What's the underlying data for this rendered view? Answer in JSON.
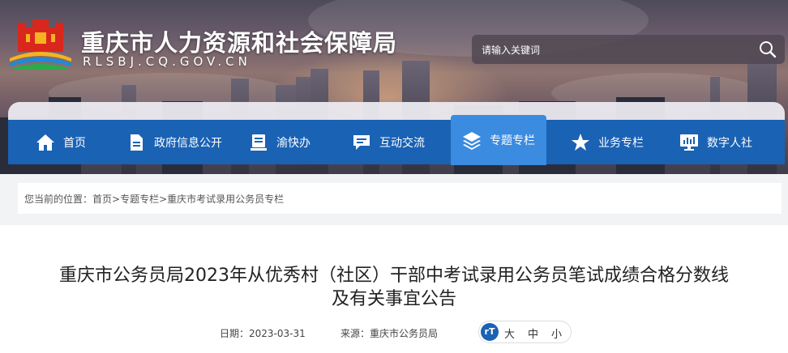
{
  "header": {
    "site_title": "重庆市人力资源和社会保障局",
    "site_domain": "RLSBJ.CQ.GOV.CN",
    "search_placeholder": "请输入关键词"
  },
  "nav": {
    "items": [
      {
        "label": "首页",
        "icon": "home-icon"
      },
      {
        "label": "政府信息公开",
        "icon": "document-icon"
      },
      {
        "label": "渝快办",
        "icon": "service-icon"
      },
      {
        "label": "互动交流",
        "icon": "chat-icon"
      },
      {
        "label": "专题专栏",
        "icon": "layers-icon",
        "active": true
      },
      {
        "label": "业务专栏",
        "icon": "star-icon"
      },
      {
        "label": "数字人社",
        "icon": "monitor-icon"
      }
    ]
  },
  "breadcrumb": {
    "prefix": "您当前的位置：",
    "items": [
      "首页",
      "专题专栏",
      "重庆市考试录用公务员专栏"
    ],
    "separator": ">"
  },
  "article": {
    "title_line1": "重庆市公务员局2023年从优秀村（社区）干部中考试录用公务员笔试成绩合格分数线",
    "title_line2": "及有关事宜公告",
    "date_label": "日期：",
    "date": "2023-03-31",
    "source_label": "来源：",
    "source": "重庆市公务员局",
    "font_sizes": [
      "大",
      "中",
      "小"
    ]
  },
  "colors": {
    "nav": "#1a62b4",
    "nav_active": "#3b8be0"
  }
}
